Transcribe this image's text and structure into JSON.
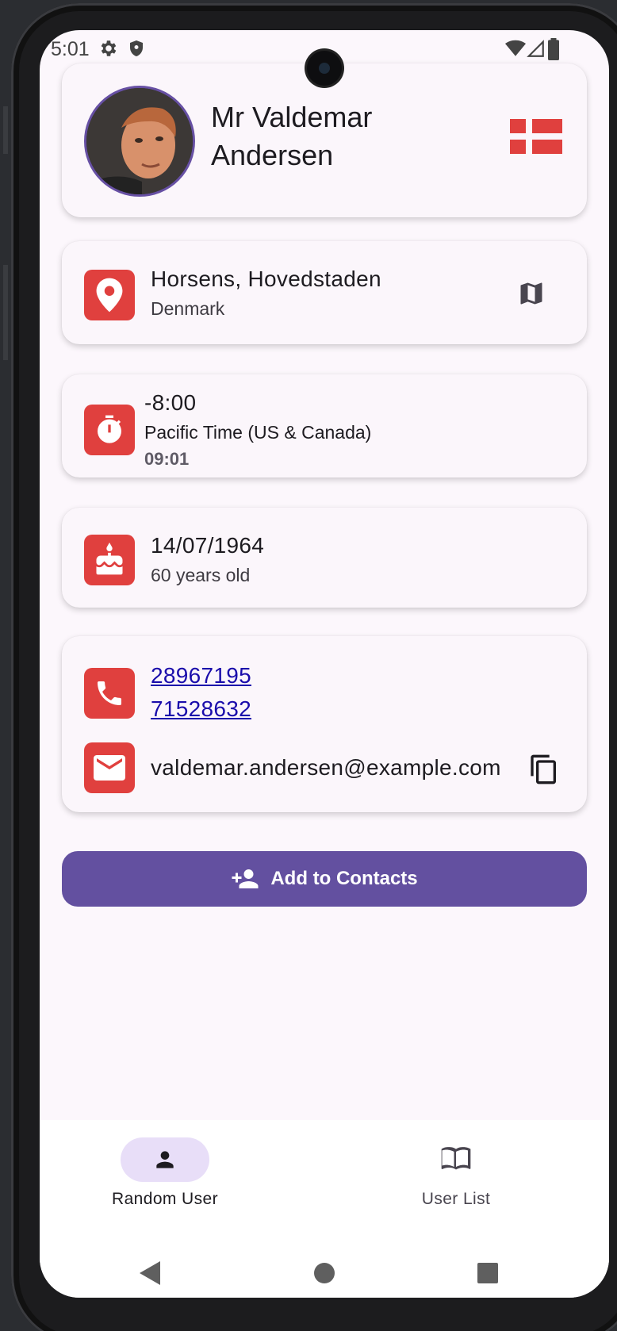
{
  "status_bar": {
    "time": "5:01",
    "icons": [
      "gear-icon",
      "shield-icon",
      "wifi-icon",
      "signal-icon",
      "battery-icon"
    ]
  },
  "profile": {
    "name_line1": "Mr Valdemar",
    "name_line2": "Andersen",
    "flag": "denmark-flag"
  },
  "location": {
    "city_region": "Horsens, Hovedstaden",
    "country": "Denmark"
  },
  "timezone": {
    "offset": "-8:00",
    "name": "Pacific Time (US & Canada)",
    "local_time": "09:01"
  },
  "birthday": {
    "date": "14/07/1964",
    "age": "60 years old"
  },
  "contact": {
    "phone1": "28967195",
    "phone2": "71528632",
    "email": "valdemar.andersen@example.com"
  },
  "actions": {
    "add_contacts_label": "Add to Contacts"
  },
  "bottom_nav": {
    "items": [
      {
        "label": "Random User",
        "active": true
      },
      {
        "label": "User List",
        "active": false
      }
    ]
  },
  "colors": {
    "accent": "#6350a0",
    "icon_tile": "#e0403e",
    "link": "#1a0dab",
    "nav_active_pill": "#e8def8"
  }
}
